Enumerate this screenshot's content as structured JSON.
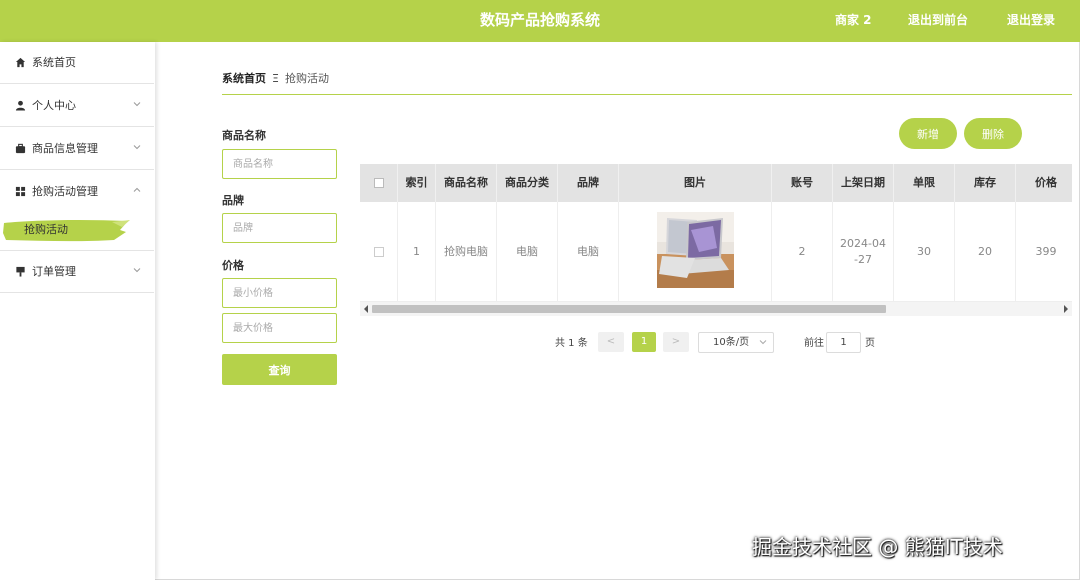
{
  "header": {
    "title": "数码产品抢购系统",
    "user": "商家 2",
    "back_to_front": "退出到前台",
    "logout": "退出登录",
    "color": "#b5d24a"
  },
  "sidebar": {
    "items": [
      {
        "label": "系统首页",
        "icon": "home-icon"
      },
      {
        "label": "个人中心",
        "icon": "user-icon"
      },
      {
        "label": "商品信息管理",
        "icon": "briefcase-icon"
      },
      {
        "label": "抢购活动管理",
        "icon": "grid-icon"
      },
      {
        "label": "订单管理",
        "icon": "order-icon"
      }
    ],
    "active_sub": "抢购活动"
  },
  "breadcrumb": {
    "home": "系统首页",
    "separator": "Ξ",
    "current": "抢购活动"
  },
  "search": {
    "name_label": "商品名称",
    "name_placeholder": "商品名称",
    "brand_label": "品牌",
    "brand_placeholder": "品牌",
    "price_label": "价格",
    "min_price_placeholder": "最小价格",
    "max_price_placeholder": "最大价格",
    "query_label": "查询"
  },
  "actions": {
    "add": "新增",
    "delete": "删除"
  },
  "table": {
    "columns": [
      "索引",
      "商品名称",
      "商品分类",
      "品牌",
      "图片",
      "账号",
      "上架日期",
      "单限",
      "库存",
      "价格"
    ],
    "rows": [
      {
        "index": "1",
        "name": "抢购电脑",
        "category": "电脑",
        "brand": "电脑",
        "account": "2",
        "date": "2024-04-27",
        "date_line1": "2024-04",
        "date_line2": "-27",
        "limit": "30",
        "stock": "20",
        "price": "399"
      }
    ]
  },
  "pagination": {
    "total": "共 1 条",
    "prev": "<",
    "current": "1",
    "next": ">",
    "page_size": "10条/页",
    "goto_label": "前往",
    "goto_value": "1",
    "page_suffix": "页"
  },
  "watermark": "掘金技术社区 @ 熊猫IT技术"
}
